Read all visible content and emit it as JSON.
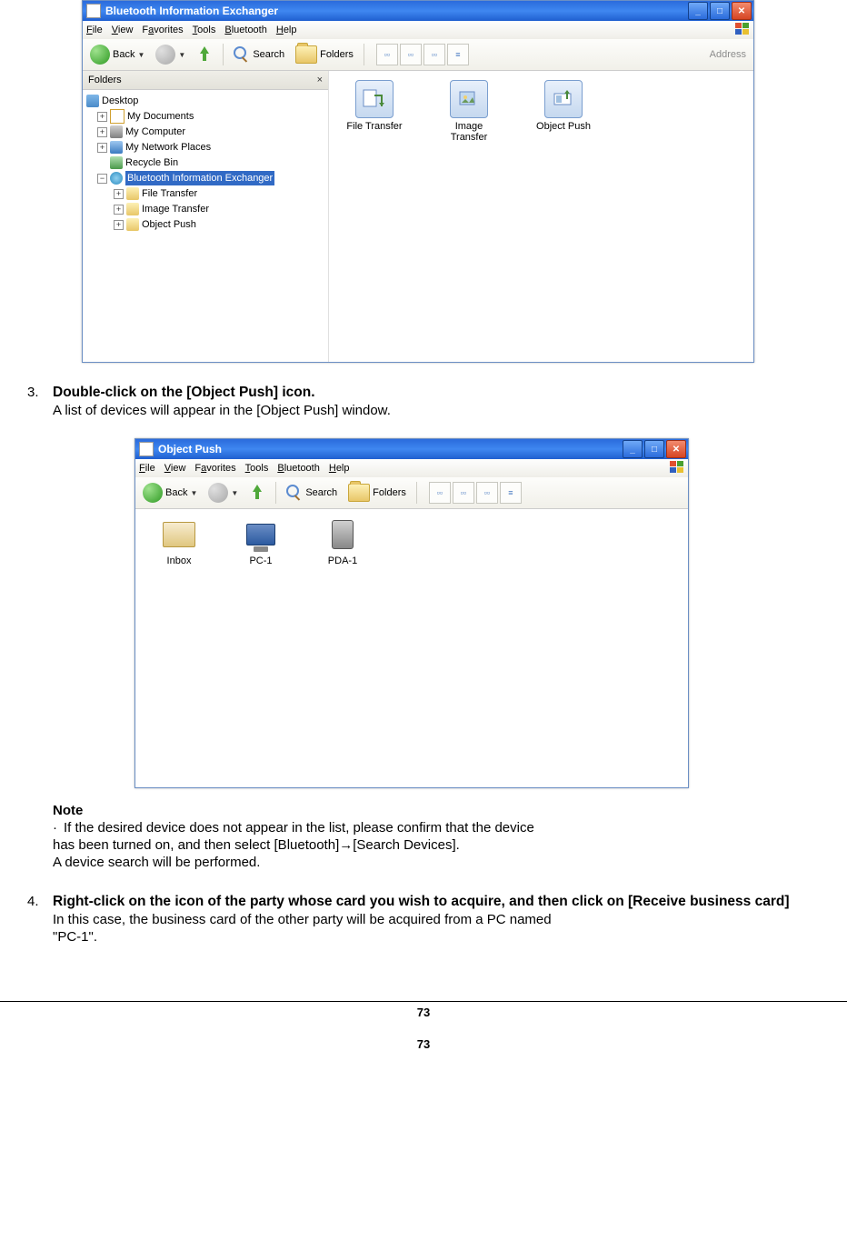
{
  "window1": {
    "title": "Bluetooth Information Exchanger",
    "menu": {
      "file": "File",
      "view": "View",
      "favorites": "Favorites",
      "tools": "Tools",
      "bluetooth": "Bluetooth",
      "help": "Help"
    },
    "toolbar": {
      "back": "Back",
      "search": "Search",
      "folders": "Folders",
      "address": "Address"
    },
    "foldersPane": {
      "header": "Folders",
      "items": {
        "desktop": "Desktop",
        "mydocs": "My Documents",
        "mycomp": "My Computer",
        "mynet": "My Network Places",
        "recycle": "Recycle Bin",
        "btexch": "Bluetooth Information Exchanger",
        "filetransfer": "File Transfer",
        "imagetransfer": "Image Transfer",
        "objectpush": "Object Push"
      }
    },
    "content": {
      "item1": "File Transfer",
      "item2": "Image Transfer",
      "item2b": "",
      "item3": "Object Push"
    },
    "content_line2": {
      "item2": "Transfer"
    }
  },
  "step3": {
    "num": "3.",
    "title": "Double-click on the [Object Push] icon.",
    "line": "A list of devices will appear in the [Object Push] window."
  },
  "window2": {
    "title": "Object Push",
    "menu": {
      "file": "File",
      "view": "View",
      "favorites": "Favorites",
      "tools": "Tools",
      "bluetooth": "Bluetooth",
      "help": "Help"
    },
    "toolbar": {
      "back": "Back",
      "search": "Search",
      "folders": "Folders"
    },
    "items": {
      "inbox": "Inbox",
      "pc1": "PC-1",
      "pda1": "PDA-1"
    }
  },
  "note": {
    "title": "Note",
    "line1": "If the desired device does not appear in the list, please confirm that the device",
    "line2": "has been turned on, and then select [Bluetooth]→[Search Devices].",
    "line3": "A device search will be performed."
  },
  "step4": {
    "num": "4.",
    "title": "Right-click on the icon of the party whose card you wish to acquire, and then click on [Receive business card]",
    "line1": "In this case, the business card of the other party will be acquired from a PC named",
    "line2": "\"PC-1\"."
  },
  "page_number": "73"
}
